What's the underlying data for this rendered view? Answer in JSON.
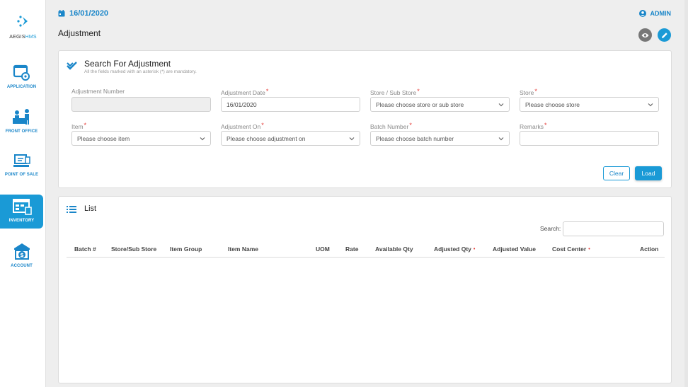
{
  "app": {
    "logo_prefix": "AEGIS",
    "logo_suffix": "HMS"
  },
  "sidebar": {
    "items": [
      {
        "label": "APPLICATION",
        "icon": "application-icon"
      },
      {
        "label": "FRONT OFFICE",
        "icon": "front-office-icon"
      },
      {
        "label": "POINT OF SALE",
        "icon": "point-of-sale-icon"
      },
      {
        "label": "INVENTORY",
        "icon": "inventory-icon",
        "active": true
      },
      {
        "label": "ACCOUNT",
        "icon": "account-icon"
      }
    ]
  },
  "topbar": {
    "date": "16/01/2020",
    "user": "ADMIN"
  },
  "page": {
    "title": "Adjustment"
  },
  "search_card": {
    "title": "Search For Adjustment",
    "subtitle": "All the fields marked with an asterisk (*) are mandatory.",
    "fields": {
      "adjustment_number": {
        "label": "Adjustment Number",
        "value": ""
      },
      "adjustment_date": {
        "label": "Adjustment Date",
        "value": "16/01/2020"
      },
      "store_sub_store": {
        "label": "Store / Sub Store",
        "placeholder": "Please choose store or sub store"
      },
      "store": {
        "label": "Store",
        "placeholder": "Please choose store"
      },
      "item": {
        "label": "Item",
        "placeholder": "Please choose item"
      },
      "adjustment_on": {
        "label": "Adjustment On",
        "placeholder": "Please choose adjustment on"
      },
      "batch_number": {
        "label": "Batch Number",
        "placeholder": "Please choose batch number"
      },
      "remarks": {
        "label": "Remarks",
        "value": ""
      }
    },
    "required_marker": "*",
    "clear_label": "Clear",
    "load_label": "Load"
  },
  "list_card": {
    "title": "List",
    "search_label": "Search:",
    "columns": [
      "Batch #",
      "Store/Sub Store",
      "Item Group",
      "Item Name",
      "UOM",
      "Rate",
      "Available Qty",
      "Adjusted Qty",
      "Adjusted Value",
      "Cost Center",
      "Action"
    ],
    "column_marker": "•",
    "rows": []
  },
  "colors": {
    "accent": "#1a9ad6",
    "required": "#e53935",
    "background": "#eeeeee"
  }
}
